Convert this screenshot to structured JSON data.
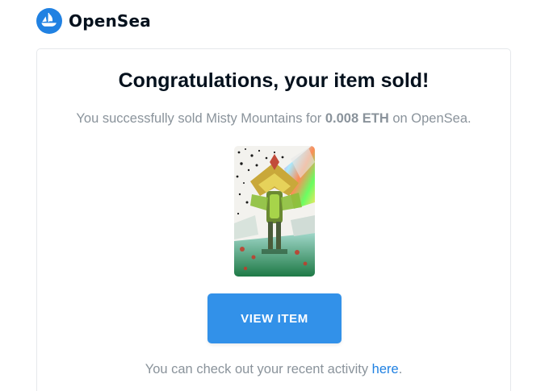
{
  "brand": {
    "name": "OpenSea",
    "icon": "opensea-logo-icon",
    "color": "#2081e2"
  },
  "email": {
    "title": "Congratulations, your item sold!",
    "message": {
      "prefix": "You successfully sold Misty Mountains for ",
      "price": "0.008 ETH",
      "suffix": " on OpenSea."
    },
    "item_image": {
      "icon": "nft-artwork-image"
    },
    "view_button_label": "VIEW ITEM",
    "activity": {
      "prefix": "You can check out your recent activity ",
      "link_text": "here",
      "suffix": "."
    }
  },
  "colors": {
    "accent": "#3291e9",
    "link": "#2081e2",
    "text_muted": "#8a939b",
    "text_dark": "#04111d"
  }
}
